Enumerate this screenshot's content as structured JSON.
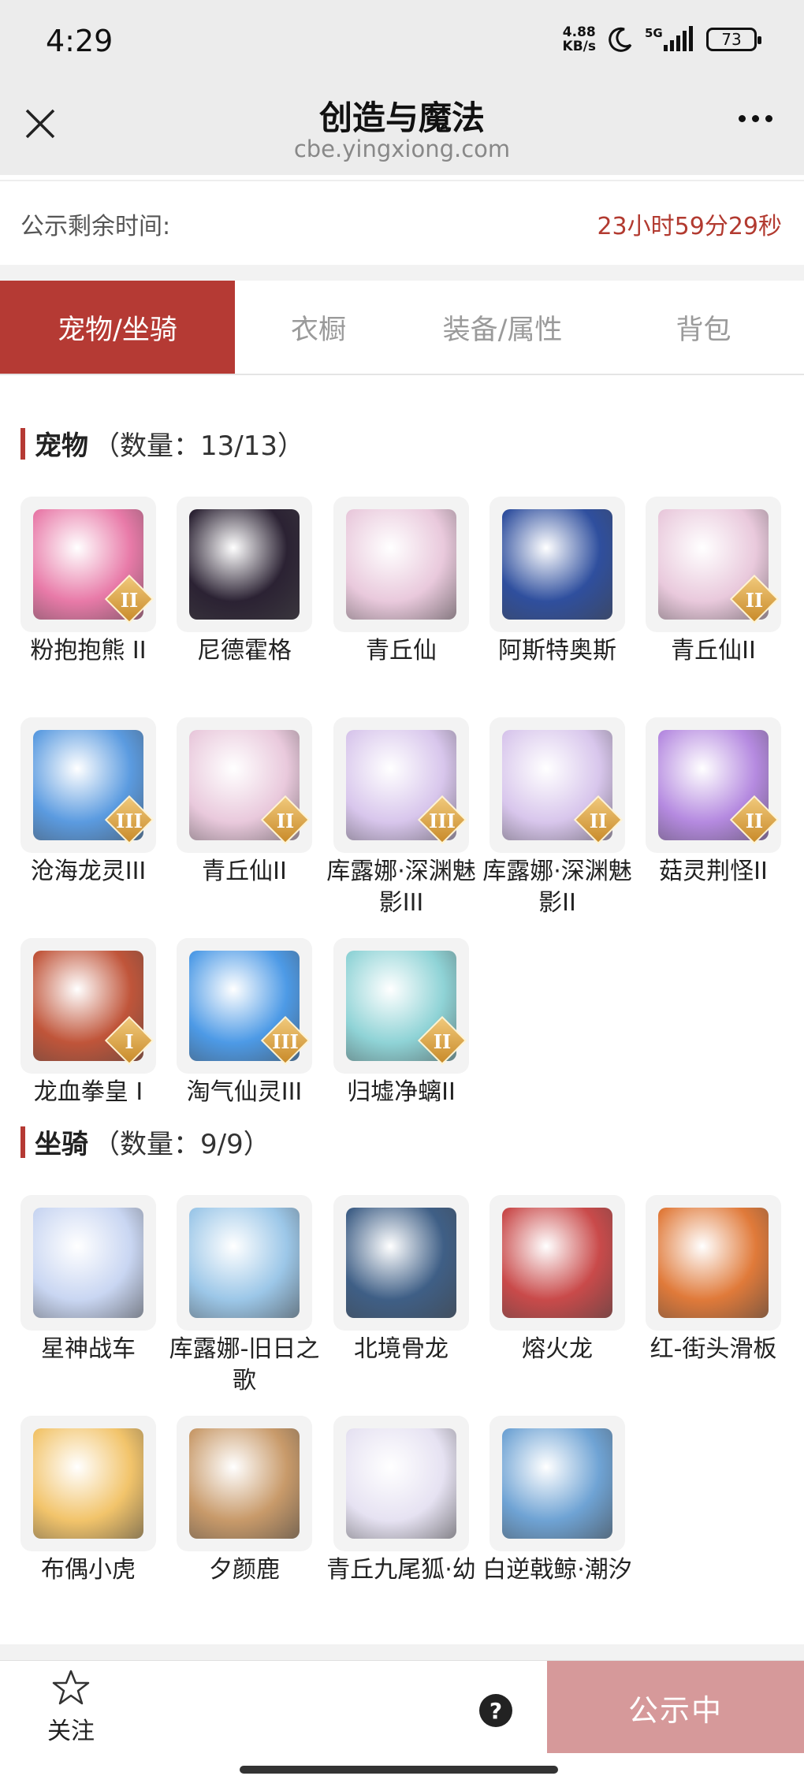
{
  "status_bar": {
    "time": "4:29",
    "net_speed_value": "4.88",
    "net_speed_unit": "KB/s",
    "network": "5G",
    "battery": "73"
  },
  "header": {
    "title": "创造与魔法",
    "url": "cbe.yingxiong.com",
    "close_icon": "close-icon",
    "more_icon": "more-icon"
  },
  "timer": {
    "label": "公示剩余时间:",
    "value": "23小时59分29秒"
  },
  "tabs": [
    {
      "label": "宠物/坐骑",
      "active": true
    },
    {
      "label": "衣橱",
      "active": false
    },
    {
      "label": "装备/属性",
      "active": false
    },
    {
      "label": "背包",
      "active": false
    }
  ],
  "pets_section": {
    "title": "宠物",
    "count": "（数量：13/13）",
    "items": [
      {
        "name": "粉抱抱熊 II",
        "grade": "II",
        "color": "#e87aa8"
      },
      {
        "name": "尼德霍格",
        "grade": "",
        "color": "#2b2233"
      },
      {
        "name": "青丘仙",
        "grade": "",
        "color": "#e9c9dc"
      },
      {
        "name": "阿斯特奥斯",
        "grade": "",
        "color": "#2f4f9e"
      },
      {
        "name": "青丘仙II",
        "grade": "II",
        "color": "#e9c9dc"
      },
      {
        "name": "沧海龙灵III",
        "grade": "III",
        "color": "#5b9be0"
      },
      {
        "name": "青丘仙II",
        "grade": "II",
        "color": "#e9c9dc"
      },
      {
        "name": "库露娜·深渊魅影III",
        "grade": "III",
        "color": "#d8c6ec"
      },
      {
        "name": "库露娜·深渊魅影II",
        "grade": "II",
        "color": "#d8c6ec"
      },
      {
        "name": "菇灵荆怪II",
        "grade": "II",
        "color": "#b58ae0"
      },
      {
        "name": "龙血拳皇 I",
        "grade": "I",
        "color": "#c0553a"
      },
      {
        "name": "淘气仙灵III",
        "grade": "III",
        "color": "#4d9ae6"
      },
      {
        "name": "归墟净螭II",
        "grade": "II",
        "color": "#8fd3d6"
      }
    ]
  },
  "mounts_section": {
    "title": "坐骑",
    "count": "（数量：9/9）",
    "items": [
      {
        "name": "星神战车",
        "grade": "",
        "color": "#c9d6f2"
      },
      {
        "name": "库露娜-旧日之歌",
        "grade": "",
        "color": "#9cc7e8"
      },
      {
        "name": "北境骨龙",
        "grade": "",
        "color": "#3f5f86"
      },
      {
        "name": "熔火龙",
        "grade": "",
        "color": "#c94a4a"
      },
      {
        "name": "红-街头滑板",
        "grade": "",
        "color": "#e07a3a"
      },
      {
        "name": "布偶小虎",
        "grade": "",
        "color": "#f2c46b"
      },
      {
        "name": "夕颜鹿",
        "grade": "",
        "color": "#c89a6a"
      },
      {
        "name": "青丘九尾狐·幼",
        "grade": "",
        "color": "#e6e2f2"
      },
      {
        "name": "白逆戟鲸·潮汐",
        "grade": "",
        "color": "#6fa3d4"
      }
    ]
  },
  "bottom_bar": {
    "follow_label": "关注",
    "help_symbol": "?",
    "status_button": "公示中"
  }
}
